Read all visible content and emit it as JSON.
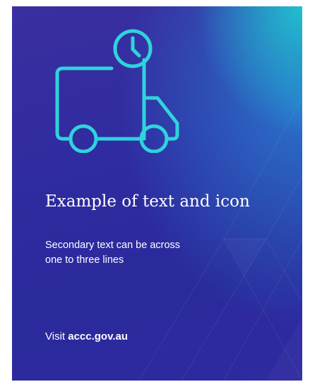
{
  "card": {
    "icon": "delivery-truck-clock-icon",
    "title": "Example of text and icon",
    "secondary_lines": [
      "Secondary text can be across",
      "one to three lines"
    ],
    "visit_prefix": "Visit ",
    "visit_link": "accc.gov.au"
  },
  "colors": {
    "background_primary": "#2f2ba0",
    "background_accent": "#1ed2d2",
    "icon_stroke": "#2fd3dc",
    "text": "#ffffff"
  }
}
